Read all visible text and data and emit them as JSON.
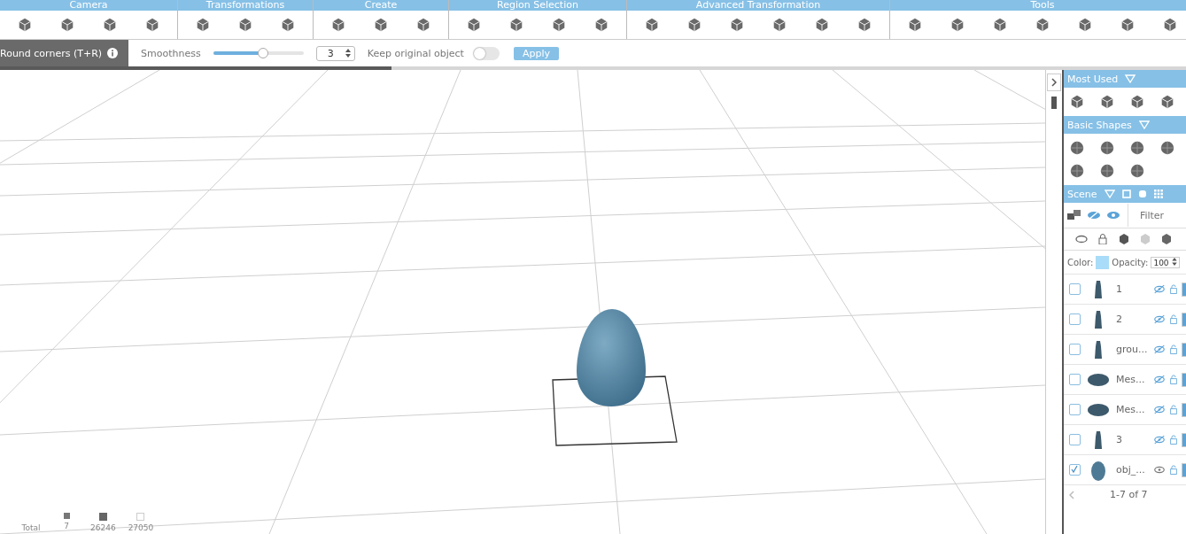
{
  "toolbar": {
    "groups": [
      {
        "label": "Camera"
      },
      {
        "label": "Transformations"
      },
      {
        "label": "Create"
      },
      {
        "label": "Region Selection"
      },
      {
        "label": "Advanced Transformation"
      },
      {
        "label": "Tools"
      }
    ]
  },
  "options_bar": {
    "title": "Round corners (T+R)",
    "smoothness_label": "Smoothness",
    "smoothness": {
      "level": 0.55
    },
    "smoothness_value": "3",
    "keep_label": "Keep original object",
    "keep_original": {
      "on": false
    },
    "apply": "Apply"
  },
  "loading": {
    "level": 0.33
  },
  "viewport": {
    "stats": {
      "label": "Total",
      "values": [
        "7",
        "26246",
        "27050"
      ]
    }
  },
  "sidebar": {
    "most_used": {
      "title": "Most Used"
    },
    "basic_shapes": {
      "title": "Basic Shapes"
    },
    "scene": {
      "title": "Scene",
      "filter_placeholder": "Filter",
      "color_label": "Color:",
      "color": "#a8dcf8",
      "opacity_label": "Opacity:",
      "opacity": "100",
      "objects": [
        {
          "name": "1",
          "kind": "figure",
          "checked": false,
          "hidden": true
        },
        {
          "name": "2",
          "kind": "figure",
          "checked": false,
          "hidden": true
        },
        {
          "name": "grou...",
          "kind": "figure",
          "checked": false,
          "hidden": true
        },
        {
          "name": "Mes...",
          "kind": "disc",
          "checked": false,
          "hidden": true
        },
        {
          "name": "Mes...",
          "kind": "disc",
          "checked": false,
          "hidden": true
        },
        {
          "name": "3",
          "kind": "figure",
          "checked": false,
          "hidden": true
        },
        {
          "name": "obj_...",
          "kind": "egg",
          "checked": true,
          "hidden": false
        }
      ],
      "pagination": "1-7 of 7"
    }
  }
}
